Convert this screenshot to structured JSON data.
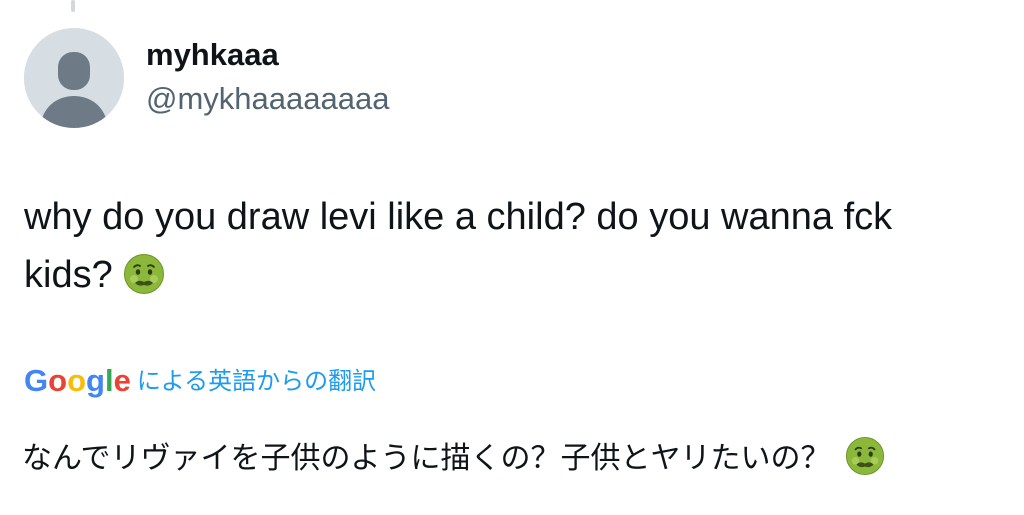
{
  "author": {
    "display_name": "myhkaaa",
    "handle": "@mykhaaaaaaaa"
  },
  "tweet": {
    "line1": "why do you draw levi like a child? do you wanna fck",
    "line2": "kids?",
    "emoji": "nauseated-face-icon"
  },
  "translation": {
    "google_letters": [
      "G",
      "o",
      "o",
      "g",
      "l",
      "e"
    ],
    "google_colors": [
      "#4285F4",
      "#EA4335",
      "#FBBC05",
      "#4285F4",
      "#34A853",
      "#EA4335"
    ],
    "label": "による英語からの翻訳",
    "text": "なんでリヴァイを子供のように描くの？子供とヤリたいの？",
    "emoji": "nauseated-face-icon"
  },
  "colors": {
    "link": "#1d9bf0",
    "secondary_text": "#536471",
    "avatar_bg": "#d6dde3",
    "avatar_figure": "#6e7b87"
  }
}
